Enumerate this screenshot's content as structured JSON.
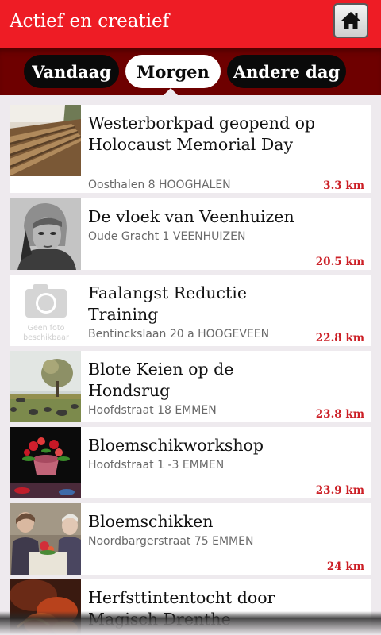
{
  "header": {
    "title": "Actief en creatief",
    "home_icon": "home-icon"
  },
  "tabs": [
    {
      "label": "Vandaag",
      "active": false
    },
    {
      "label": "Morgen",
      "active": true
    },
    {
      "label": "Andere dag",
      "active": false
    }
  ],
  "events": [
    {
      "title": "Westerborkpad geopend op Holocaust Memorial Day",
      "address": "Oosthalen 8 HOOGHALEN",
      "distance": "3.3 km",
      "thumb": "railway-photo"
    },
    {
      "title": "De vloek van Veenhuizen",
      "address": "Oude Gracht 1 VEENHUIZEN",
      "distance": "20.5 km",
      "thumb": "portrait-photo"
    },
    {
      "title": "Faalangst Reductie Training",
      "address": "Bentinckslaan 20 a HOOGEVEEN",
      "distance": "22.8 km",
      "thumb": "no-photo-placeholder",
      "placeholder_text": "Geen foto beschikbaar"
    },
    {
      "title": "Blote Keien op de Hondsrug",
      "address": "Hoofdstraat 18 EMMEN",
      "distance": "23.8 km",
      "thumb": "tree-field-photo"
    },
    {
      "title": "Bloemschikworkshop",
      "address": "Hoofdstraat 1 -3 EMMEN",
      "distance": "23.9 km",
      "thumb": "flower-arrangement-photo"
    },
    {
      "title": "Bloemschikken",
      "address": "Noordbargerstraat 75 EMMEN",
      "distance": "24 km",
      "thumb": "people-table-photo"
    },
    {
      "title": "Herfsttintentocht door Magisch Drenthe",
      "address": "",
      "distance": "",
      "thumb": "autumn-leaves-photo"
    }
  ]
}
